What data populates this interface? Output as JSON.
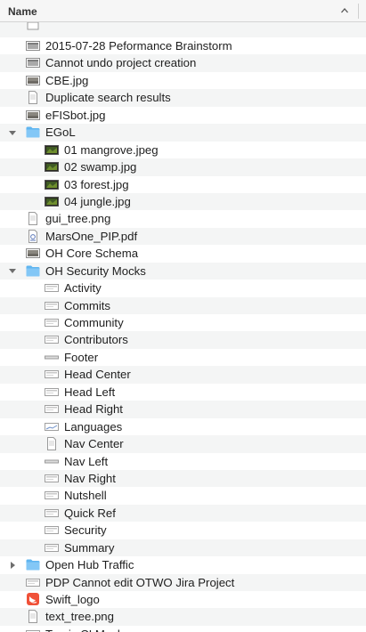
{
  "header": {
    "name_label": "Name",
    "sort_icon": "chevron-up-icon"
  },
  "rows": [
    {
      "label": "",
      "level": 0,
      "icon": "partial-file-icon"
    },
    {
      "label": "2015-07-28 Peformance Brainstorm",
      "level": 0,
      "icon": "screenshot-file-icon"
    },
    {
      "label": "Cannot undo project creation",
      "level": 0,
      "icon": "screenshot-file-icon"
    },
    {
      "label": "CBE.jpg",
      "level": 0,
      "icon": "image-file-icon"
    },
    {
      "label": "Duplicate search results",
      "level": 0,
      "icon": "document-file-icon"
    },
    {
      "label": "eFISbot.jpg",
      "level": 0,
      "icon": "image-file-icon"
    },
    {
      "label": "EGoL",
      "level": 0,
      "icon": "folder-icon",
      "disclosure": "expanded"
    },
    {
      "label": "01 mangrove.jpeg",
      "level": 1,
      "icon": "green-photo-icon"
    },
    {
      "label": "02 swamp.jpg",
      "level": 1,
      "icon": "green-photo-icon"
    },
    {
      "label": "03 forest.jpg",
      "level": 1,
      "icon": "green-photo-icon"
    },
    {
      "label": "04 jungle.jpg",
      "level": 1,
      "icon": "green-photo-icon"
    },
    {
      "label": "gui_tree.png",
      "level": 0,
      "icon": "document-file-icon"
    },
    {
      "label": "MarsOne_PIP.pdf",
      "level": 0,
      "icon": "pdf-file-icon"
    },
    {
      "label": "OH Core Schema",
      "level": 0,
      "icon": "image-file-icon"
    },
    {
      "label": "OH Security Mocks",
      "level": 0,
      "icon": "folder-icon",
      "disclosure": "expanded"
    },
    {
      "label": "Activity",
      "level": 1,
      "icon": "mock-file-icon"
    },
    {
      "label": "Commits",
      "level": 1,
      "icon": "mock-file-icon"
    },
    {
      "label": "Community",
      "level": 1,
      "icon": "mock-file-icon"
    },
    {
      "label": "Contributors",
      "level": 1,
      "icon": "mock-file-icon"
    },
    {
      "label": "Footer",
      "level": 1,
      "icon": "strip-file-icon"
    },
    {
      "label": "Head Center",
      "level": 1,
      "icon": "mock-file-icon"
    },
    {
      "label": "Head Left",
      "level": 1,
      "icon": "mock-file-icon"
    },
    {
      "label": "Head Right",
      "level": 1,
      "icon": "mock-file-icon"
    },
    {
      "label": "Languages",
      "level": 1,
      "icon": "chart-file-icon"
    },
    {
      "label": "Nav Center",
      "level": 1,
      "icon": "document-file-icon"
    },
    {
      "label": "Nav Left",
      "level": 1,
      "icon": "strip-file-icon"
    },
    {
      "label": "Nav Right",
      "level": 1,
      "icon": "mock-file-icon"
    },
    {
      "label": "Nutshell",
      "level": 1,
      "icon": "mock-file-icon"
    },
    {
      "label": "Quick Ref",
      "level": 1,
      "icon": "mock-file-icon"
    },
    {
      "label": "Security",
      "level": 1,
      "icon": "mock-file-icon"
    },
    {
      "label": "Summary",
      "level": 1,
      "icon": "mock-file-icon"
    },
    {
      "label": "Open Hub Traffic",
      "level": 0,
      "icon": "folder-icon",
      "disclosure": "collapsed"
    },
    {
      "label": "PDP Cannot edit OTWO Jira Project",
      "level": 0,
      "icon": "mock-file-icon"
    },
    {
      "label": "Swift_logo",
      "level": 0,
      "icon": "swift-logo-icon"
    },
    {
      "label": "text_tree.png",
      "level": 0,
      "icon": "document-file-icon"
    },
    {
      "label": "Travis CI Mockup",
      "level": 0,
      "icon": "mock-file-icon"
    }
  ],
  "colors": {
    "folder": "#5fb5f0",
    "folder_tab": "#83c7f6",
    "row_alt": "#f4f5f5",
    "header_bg": "#f6f6f6",
    "swift": "#f05138"
  }
}
